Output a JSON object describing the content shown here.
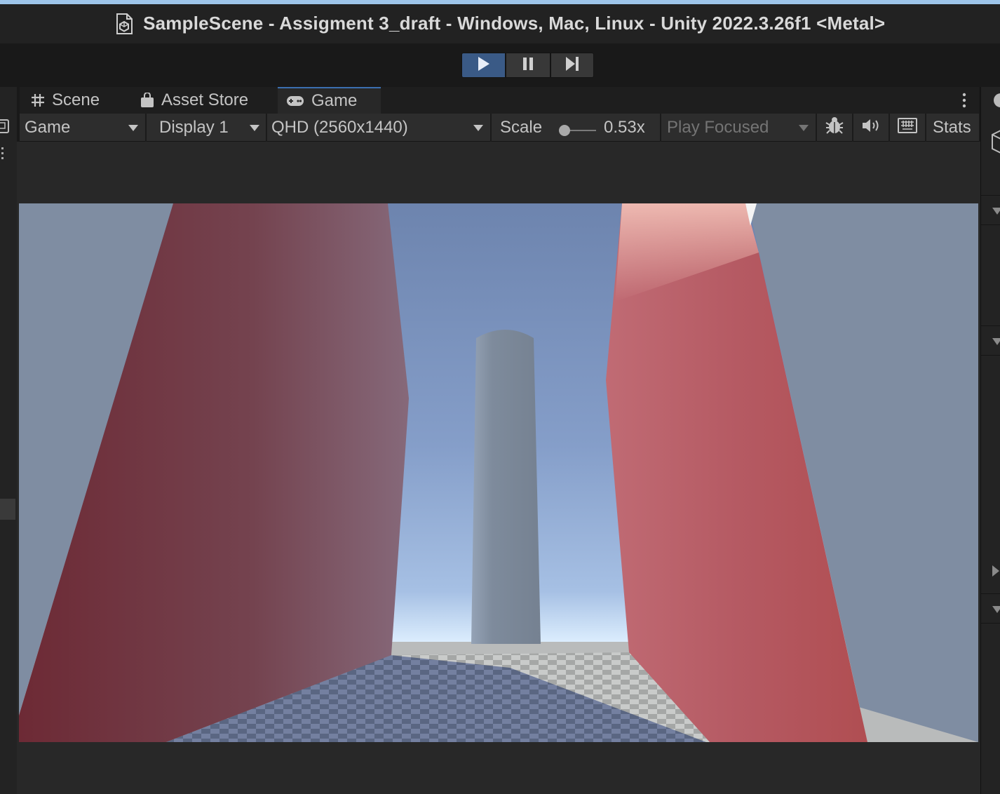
{
  "window": {
    "title": "SampleScene - Assigment 3_draft - Windows, Mac, Linux - Unity 2022.3.26f1 <Metal>"
  },
  "playmode": {
    "play_icon": "play-icon",
    "pause_icon": "pause-icon",
    "step_icon": "step-icon",
    "playing": true
  },
  "tabs": [
    {
      "label": "Scene",
      "icon": "grid-icon"
    },
    {
      "label": "Asset Store",
      "icon": "shopping-bag-icon"
    },
    {
      "label": "Game",
      "icon": "gamepad-icon",
      "active": true
    }
  ],
  "game_toolbar": {
    "view_dropdown": "Game",
    "display_dropdown": "Display 1",
    "resolution_dropdown": "QHD (2560x1440)",
    "scale_label": "Scale",
    "scale_value": "0.53x",
    "play_mode_dropdown": "Play Focused",
    "stats_label": "Stats",
    "icons": [
      "bug-icon",
      "audio-icon",
      "keyboard-icon"
    ]
  },
  "colors": {
    "accent_blue": "#3a5a86",
    "tab_underline": "#3b6fb0",
    "wall_red": "#b55558",
    "sky_blue": "#7f9bc8",
    "pillar_gray": "#7c8898"
  }
}
